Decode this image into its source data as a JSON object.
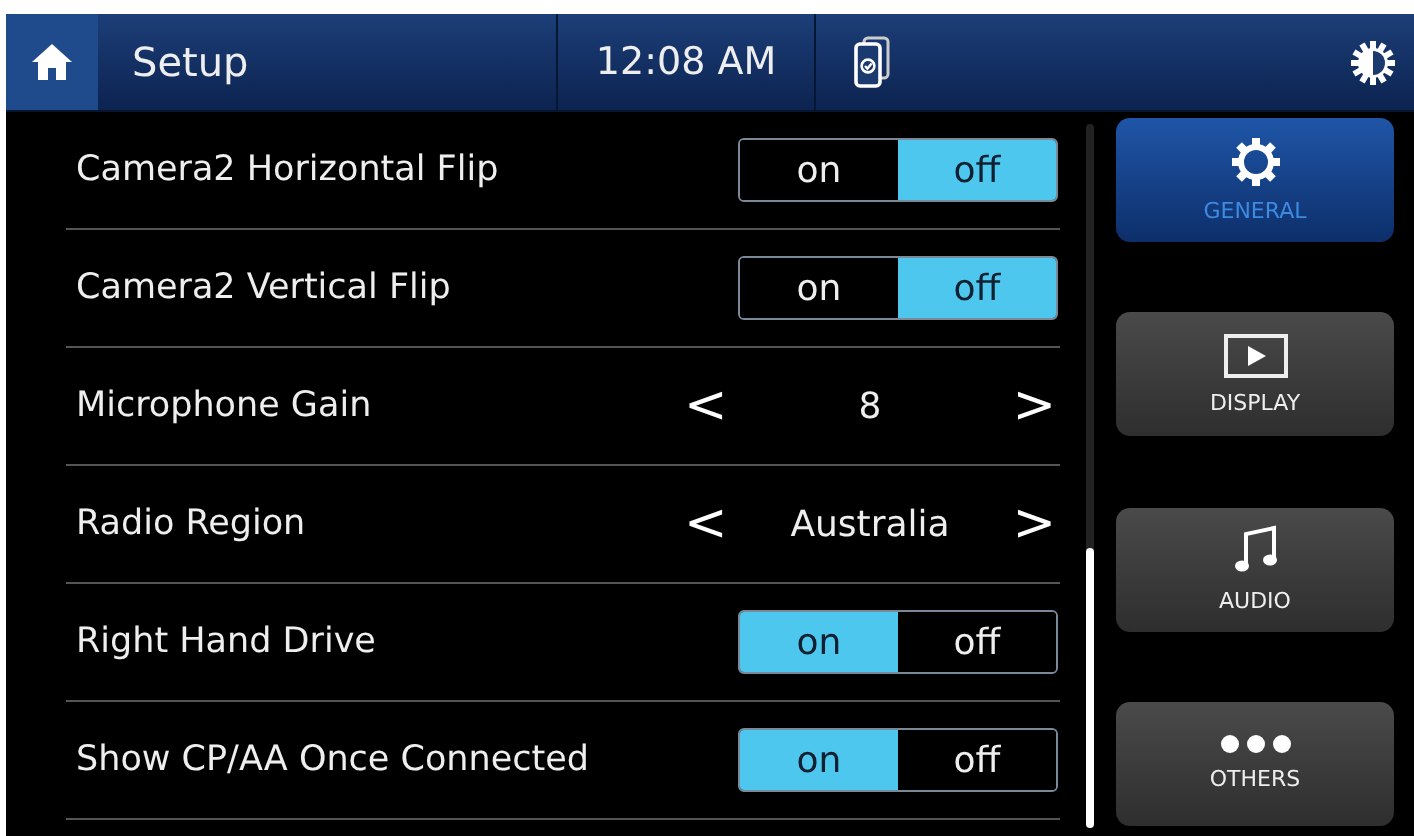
{
  "header": {
    "title": "Setup",
    "time": "12:08 AM"
  },
  "settings": [
    {
      "kind": "toggle",
      "label": "Camera2 Horizontal Flip",
      "on_label": "on",
      "off_label": "off",
      "on": false
    },
    {
      "kind": "toggle",
      "label": "Camera2 Vertical Flip",
      "on_label": "on",
      "off_label": "off",
      "on": false
    },
    {
      "kind": "selector",
      "label": "Microphone Gain",
      "prev": "<",
      "value": "8",
      "next": ">"
    },
    {
      "kind": "selector",
      "label": "Radio Region",
      "prev": "<",
      "value": "Australia",
      "next": ">"
    },
    {
      "kind": "toggle",
      "label": "Right Hand Drive",
      "on_label": "on",
      "off_label": "off",
      "on": true
    },
    {
      "kind": "toggle",
      "label": "Show CP/AA Once Connected",
      "on_label": "on",
      "off_label": "off",
      "on": true
    }
  ],
  "categories": [
    {
      "kind": "general",
      "label": "GENERAL",
      "selected": true
    },
    {
      "kind": "display",
      "label": "DISPLAY",
      "selected": false
    },
    {
      "kind": "audio",
      "label": "AUDIO",
      "selected": false
    },
    {
      "kind": "others",
      "label": "OTHERS",
      "selected": false
    }
  ]
}
